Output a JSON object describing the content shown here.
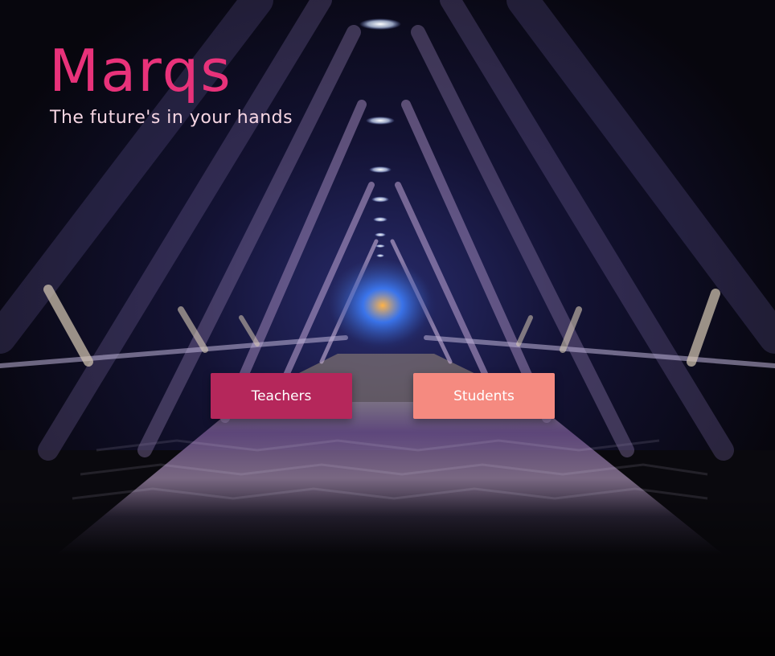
{
  "hero": {
    "title": "Marqs",
    "tagline": "The future's in your hands"
  },
  "actions": {
    "teachers_label": "Teachers",
    "students_label": "Students"
  },
  "colors": {
    "title": "#e8327a",
    "teachers_button": "#b5275b",
    "students_button": "#f58a80"
  }
}
